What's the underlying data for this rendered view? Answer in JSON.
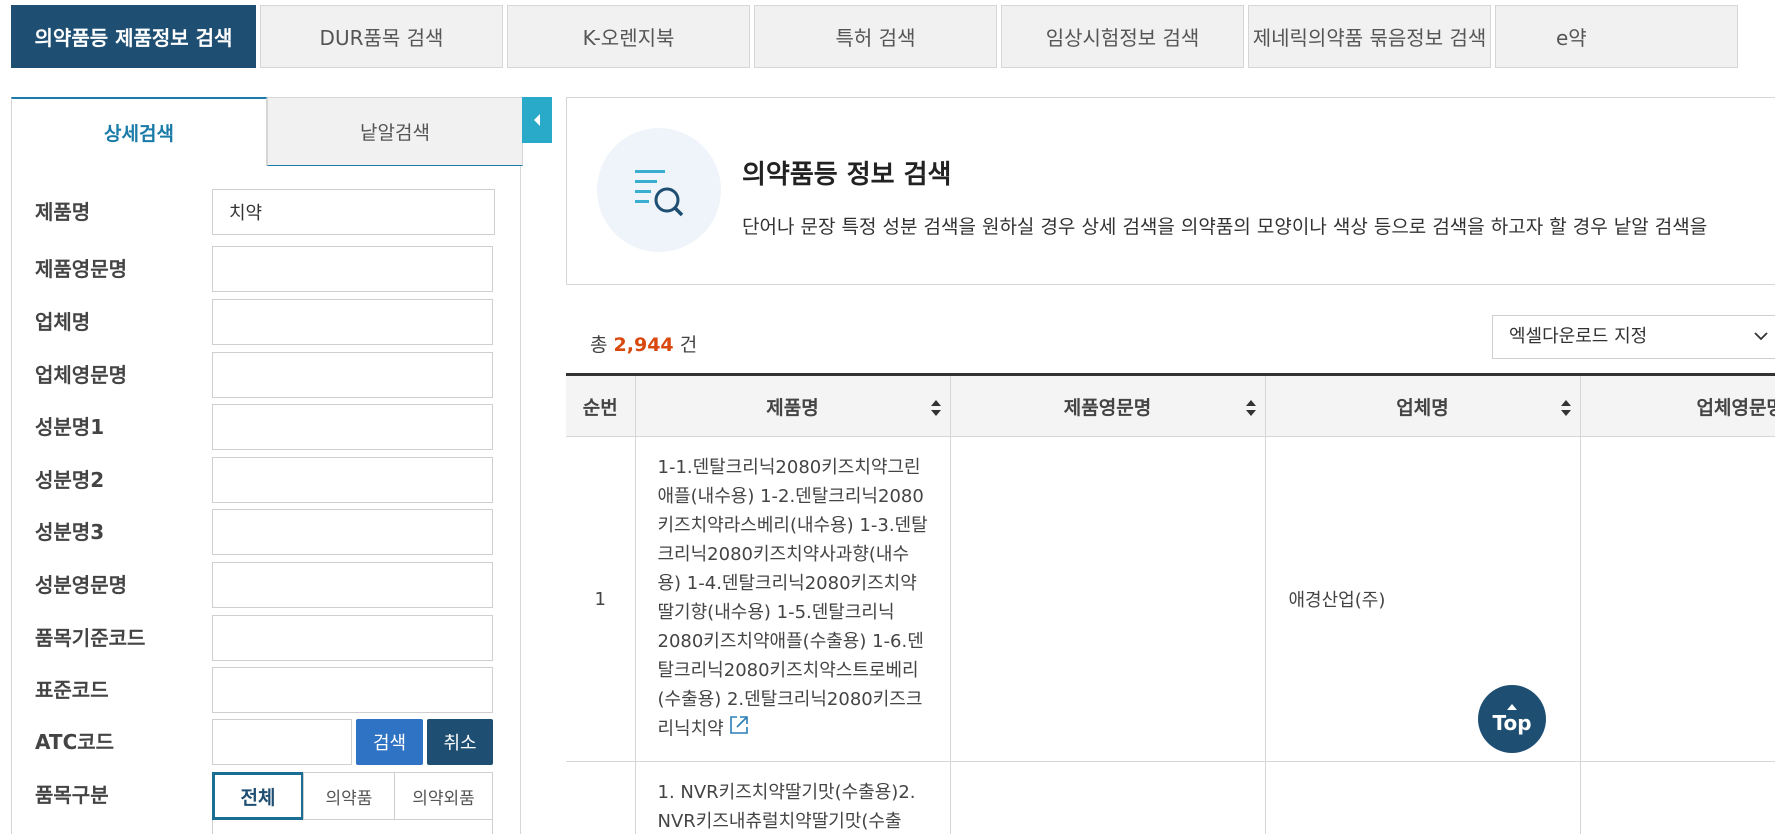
{
  "top_tabs": [
    {
      "label": "의약품등 제품정보 검색",
      "active": true
    },
    {
      "label": "DUR품목 검색",
      "active": false
    },
    {
      "label": "K-오렌지북",
      "active": false
    },
    {
      "label": "특허 검색",
      "active": false
    },
    {
      "label": "임상시험정보 검색",
      "active": false
    },
    {
      "label": "제네릭의약품 묶음정보 검색",
      "active": false
    },
    {
      "label": "e약",
      "active": false
    }
  ],
  "search_panel": {
    "tabs": {
      "detail": "상세검색",
      "pill": "낱알검색"
    },
    "fields": {
      "product_name": {
        "label": "제품명",
        "value": "치약"
      },
      "product_name_en": {
        "label": "제품영문명",
        "value": ""
      },
      "company": {
        "label": "업체명",
        "value": ""
      },
      "company_en": {
        "label": "업체영문명",
        "value": ""
      },
      "ingredient1": {
        "label": "성분명1",
        "value": ""
      },
      "ingredient2": {
        "label": "성분명2",
        "value": ""
      },
      "ingredient3": {
        "label": "성분명3",
        "value": ""
      },
      "ingredient_en": {
        "label": "성분영문명",
        "value": ""
      },
      "item_code": {
        "label": "품목기준코드",
        "value": ""
      },
      "standard_code": {
        "label": "표준코드",
        "value": ""
      },
      "atc_code": {
        "label": "ATC코드",
        "value": ""
      }
    },
    "search_button": "검색",
    "cancel_button": "취소",
    "category": {
      "label": "품목구분",
      "options": [
        "전체",
        "의약품",
        "의약외품"
      ],
      "selected": "전체"
    }
  },
  "info": {
    "title": "의약품등 정보 검색",
    "description": "단어나 문장 특정 성분 검색을 원하실 경우 상세 검색을 의약품의 모양이나 색상 등으로 검색을 하고자 할 경우 낱알 검색을"
  },
  "results": {
    "total_prefix": "총",
    "total_count": "2,944",
    "total_suffix": "건",
    "excel_select": "엑셀다운로드 지정",
    "columns": {
      "no": "순번",
      "name": "제품명",
      "name_en": "제품영문명",
      "company": "업체명",
      "company_en": "업체영문명"
    },
    "rows": [
      {
        "no": "1",
        "name": "1-1.덴탈크리닉2080키즈치약그린애플(내수용) 1-2.덴탈크리닉2080키즈치약라스베리(내수용) 1-3.덴탈크리닉2080키즈치약사과향(내수용) 1-4.덴탈크리닉2080키즈치약딸기향(내수용) 1-5.덴탈크리닉2080키즈치약애플(수출용) 1-6.덴탈크리닉2080키즈치약스트로베리(수출용) 2.덴탈크리닉2080키즈크리닉치약",
        "name_en": "",
        "company": "애경산업(주)",
        "company_en": ""
      },
      {
        "no": "",
        "name": "1. NVR키즈치약딸기맛(수출용)2. NVR키즈내츄럴치약딸기맛(수출",
        "name_en": "",
        "company": "",
        "company_en": ""
      }
    ]
  },
  "top_button": "Top"
}
